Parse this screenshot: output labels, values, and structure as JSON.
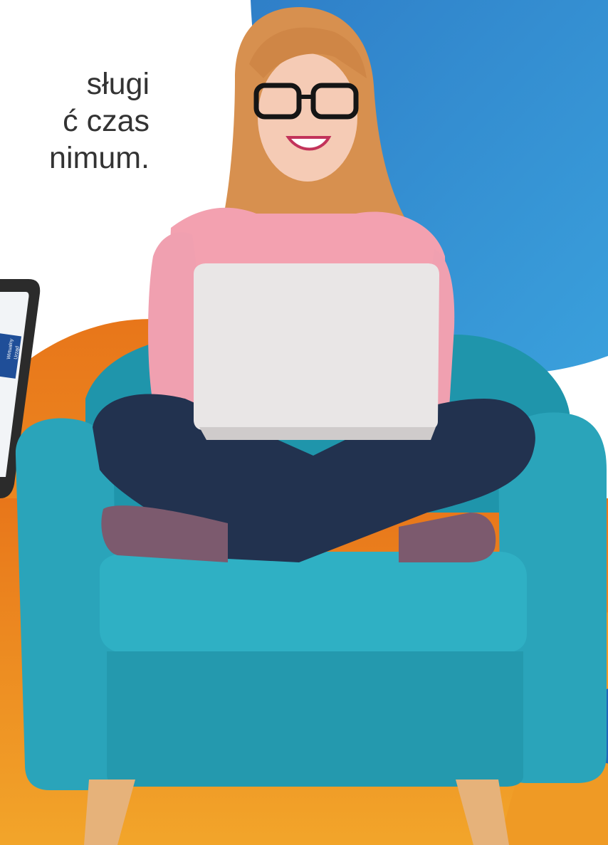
{
  "headline": {
    "lines": [
      "sługi",
      "ć czas",
      "nimum."
    ]
  },
  "tablet": {
    "screen_texts": [
      "Wirtualny",
      "Urząd"
    ]
  },
  "colors": {
    "blue_bg": "#2f8fcf",
    "orange_bg": "#ee8a1e",
    "chair_teal": "#2a9fb4",
    "laptop": "#e9e6e6",
    "shirt": "#f3a1b0",
    "jeans": "#22324f",
    "hair": "#d7904f"
  },
  "icons": {
    "right_edge_circle": "blue-circle-icon"
  }
}
